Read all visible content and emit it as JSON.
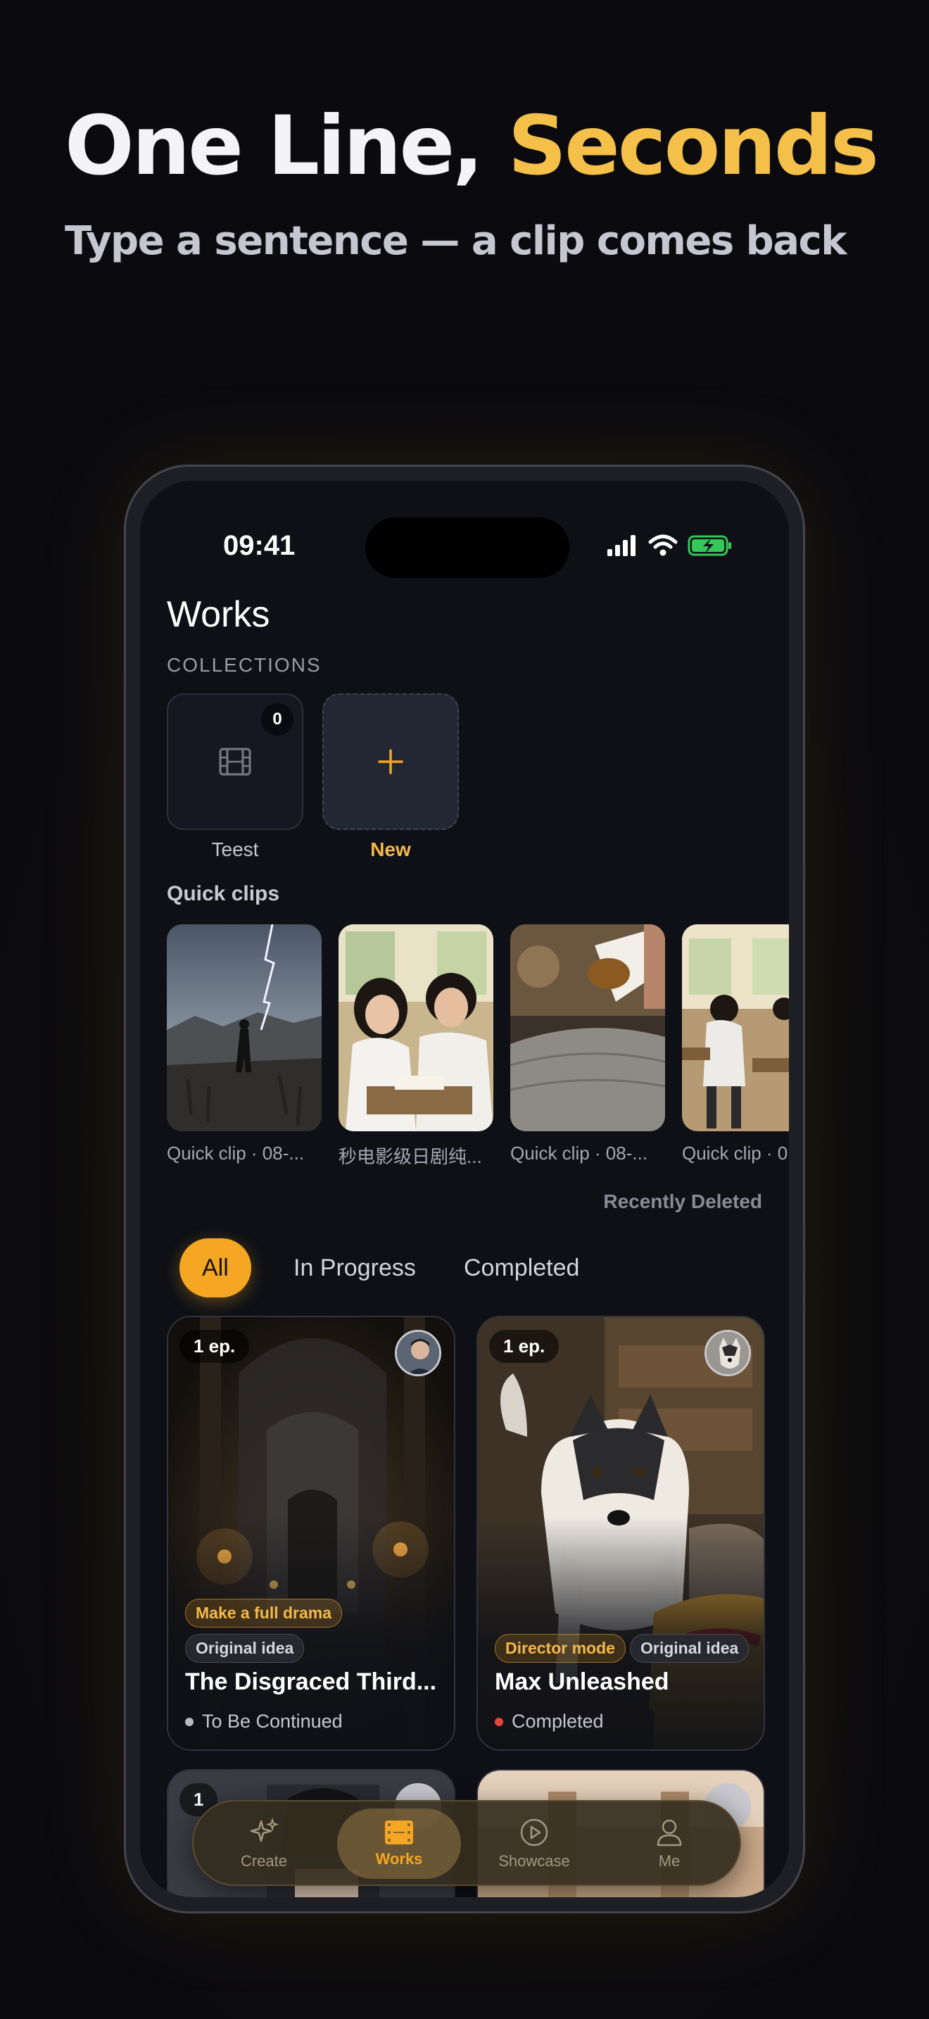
{
  "hero": {
    "title_part1": "One Line, ",
    "title_part2": "Seconds",
    "subtitle": "Type a sentence — a clip comes back"
  },
  "colors": {
    "accent": "#f5a623",
    "headline_accent": "#f5c04a",
    "background": "#0e1016"
  },
  "status_bar": {
    "time": "09:41",
    "icons": [
      "cellular-signal-icon",
      "wifi-icon",
      "battery-charging-icon"
    ]
  },
  "screen": {
    "title": "Works",
    "collections_label": "COLLECTIONS",
    "collections": [
      {
        "name": "Teest",
        "count": "0",
        "icon": "film-icon"
      },
      {
        "name": "New",
        "icon": "plus-icon"
      }
    ],
    "quick_clips_label": "Quick clips",
    "quick_clips": [
      {
        "caption": "Quick clip · 08-..."
      },
      {
        "caption": "秒电影级日剧纯..."
      },
      {
        "caption": "Quick clip · 08-..."
      },
      {
        "caption": "Quick clip · 0"
      }
    ],
    "recently_deleted": "Recently Deleted",
    "filters": [
      "All",
      "In Progress",
      "Completed"
    ],
    "active_filter": "All",
    "works": [
      {
        "episodes": "1 ep.",
        "tags": [
          "Make a full drama",
          "Original idea"
        ],
        "title": "The Disgraced Third...",
        "status": "To Be Continued",
        "status_color": "#b8b9c2"
      },
      {
        "episodes": "1 ep.",
        "tags": [
          "Director mode",
          "Original idea"
        ],
        "title": "Max Unleashed",
        "status": "Completed",
        "status_color": "#e0443a"
      },
      {
        "episodes": "1"
      },
      {
        "episodes": ""
      }
    ]
  },
  "tabbar": {
    "tabs": [
      {
        "label": "Create",
        "icon": "sparkles-icon"
      },
      {
        "label": "Works",
        "icon": "film-strip-icon"
      },
      {
        "label": "Showcase",
        "icon": "play-circle-icon"
      },
      {
        "label": "Me",
        "icon": "person-icon"
      }
    ],
    "active": "Works"
  }
}
